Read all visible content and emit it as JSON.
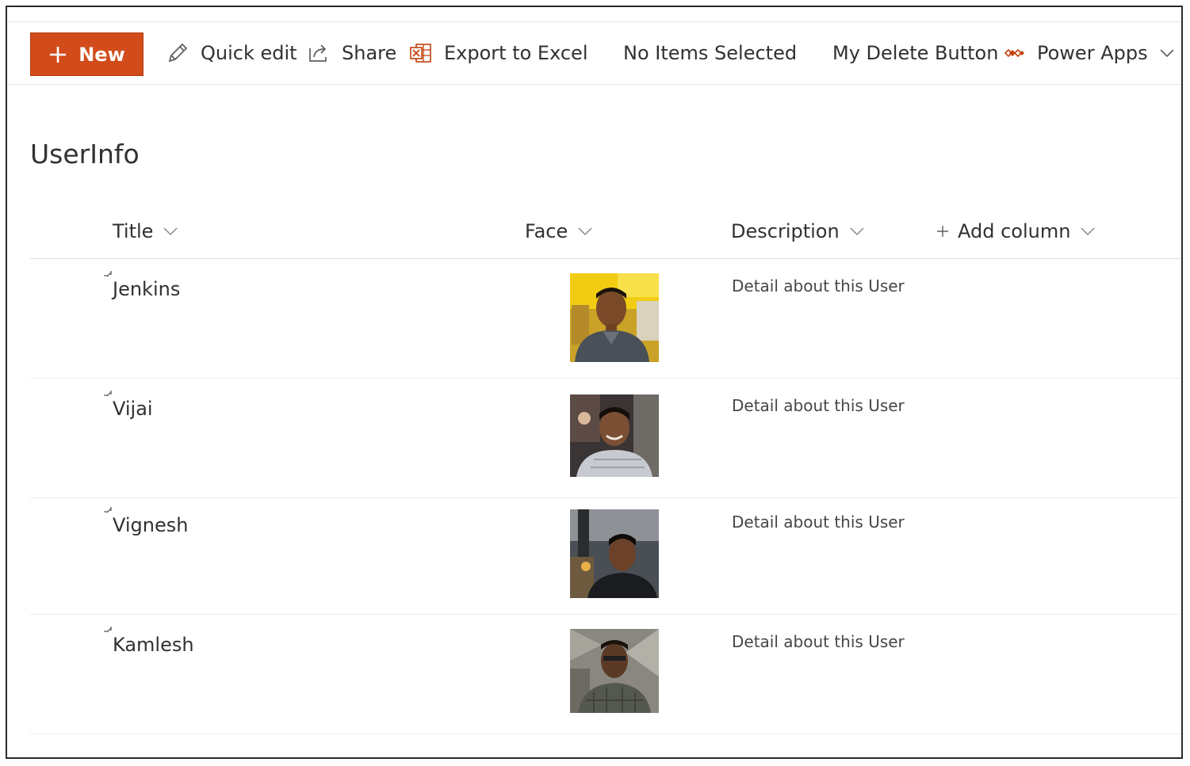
{
  "toolbar": {
    "new_label": "New",
    "quick_edit_label": "Quick edit",
    "share_label": "Share",
    "export_label": "Export to Excel",
    "selection_status": "No Items Selected",
    "delete_label": "My Delete Button",
    "power_apps_label": "Power Apps"
  },
  "list": {
    "title": "UserInfo",
    "columns": {
      "title": "Title",
      "face": "Face",
      "description": "Description",
      "add_column": "Add column"
    },
    "rows": [
      {
        "title": "Jenkins",
        "description": "Detail about this User",
        "face_icon": "user-photo"
      },
      {
        "title": "Vijai",
        "description": "Detail about this User",
        "face_icon": "user-photo"
      },
      {
        "title": "Vignesh",
        "description": "Detail about this User",
        "face_icon": "user-photo"
      },
      {
        "title": "Kamlesh",
        "description": "Detail about this User",
        "face_icon": "user-photo"
      }
    ]
  },
  "colors": {
    "accent": "#d24c1b",
    "power_apps": "#c2410c",
    "excel": "#c2410c",
    "text": "#323130",
    "divider": "#e1e1e1"
  },
  "icons": {
    "new": "plus-icon",
    "quick_edit": "pencil-icon",
    "share": "share-icon",
    "export": "excel-icon",
    "power_apps": "power-apps-icon",
    "menu": "chevron-down-icon",
    "new_item": "new-item-indicator-icon",
    "add": "plus-icon"
  }
}
